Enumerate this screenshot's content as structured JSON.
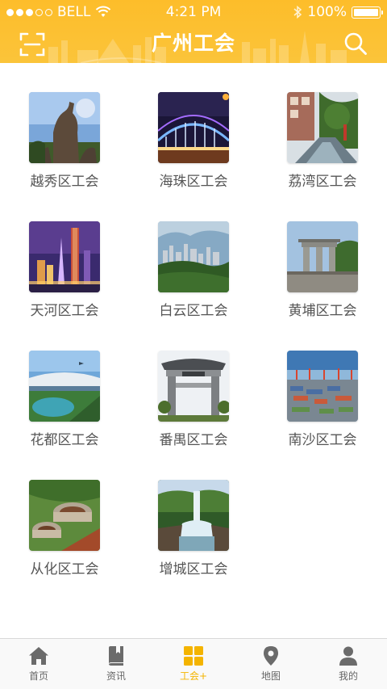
{
  "status_bar": {
    "carrier": "BELL",
    "time": "4:21 PM",
    "battery": "100%"
  },
  "header": {
    "title": "广州工会",
    "left_icon": "scan-icon",
    "right_icon": "search-icon"
  },
  "districts": [
    {
      "label": "越秀区工会",
      "photo": "goat-statue"
    },
    {
      "label": "海珠区工会",
      "photo": "bridge-lights"
    },
    {
      "label": "荔湾区工会",
      "photo": "canal-street"
    },
    {
      "label": "天河区工会",
      "photo": "skyline-night"
    },
    {
      "label": "白云区工会",
      "photo": "city-hill-view"
    },
    {
      "label": "黄埔区工会",
      "photo": "stone-gate"
    },
    {
      "label": "花都区工会",
      "photo": "airport-terminal"
    },
    {
      "label": "番禺区工会",
      "photo": "memorial-archway"
    },
    {
      "label": "南沙区工会",
      "photo": "container-port"
    },
    {
      "label": "从化区工会",
      "photo": "round-earth-buildings"
    },
    {
      "label": "增城区工会",
      "photo": "waterfall"
    }
  ],
  "tabbar": {
    "items": [
      {
        "label": "首页",
        "icon": "home-icon",
        "active": false
      },
      {
        "label": "资讯",
        "icon": "book-icon",
        "active": false
      },
      {
        "label": "工会+",
        "icon": "grid-icon",
        "active": true
      },
      {
        "label": "地图",
        "icon": "map-pin-icon",
        "active": false
      },
      {
        "label": "我的",
        "icon": "user-icon",
        "active": false
      }
    ]
  },
  "colors": {
    "header_yellow": "#fdbd2a",
    "active_tab": "#f4b400",
    "inactive_tab_icon": "#6b6b6b",
    "label_text": "#555555"
  }
}
